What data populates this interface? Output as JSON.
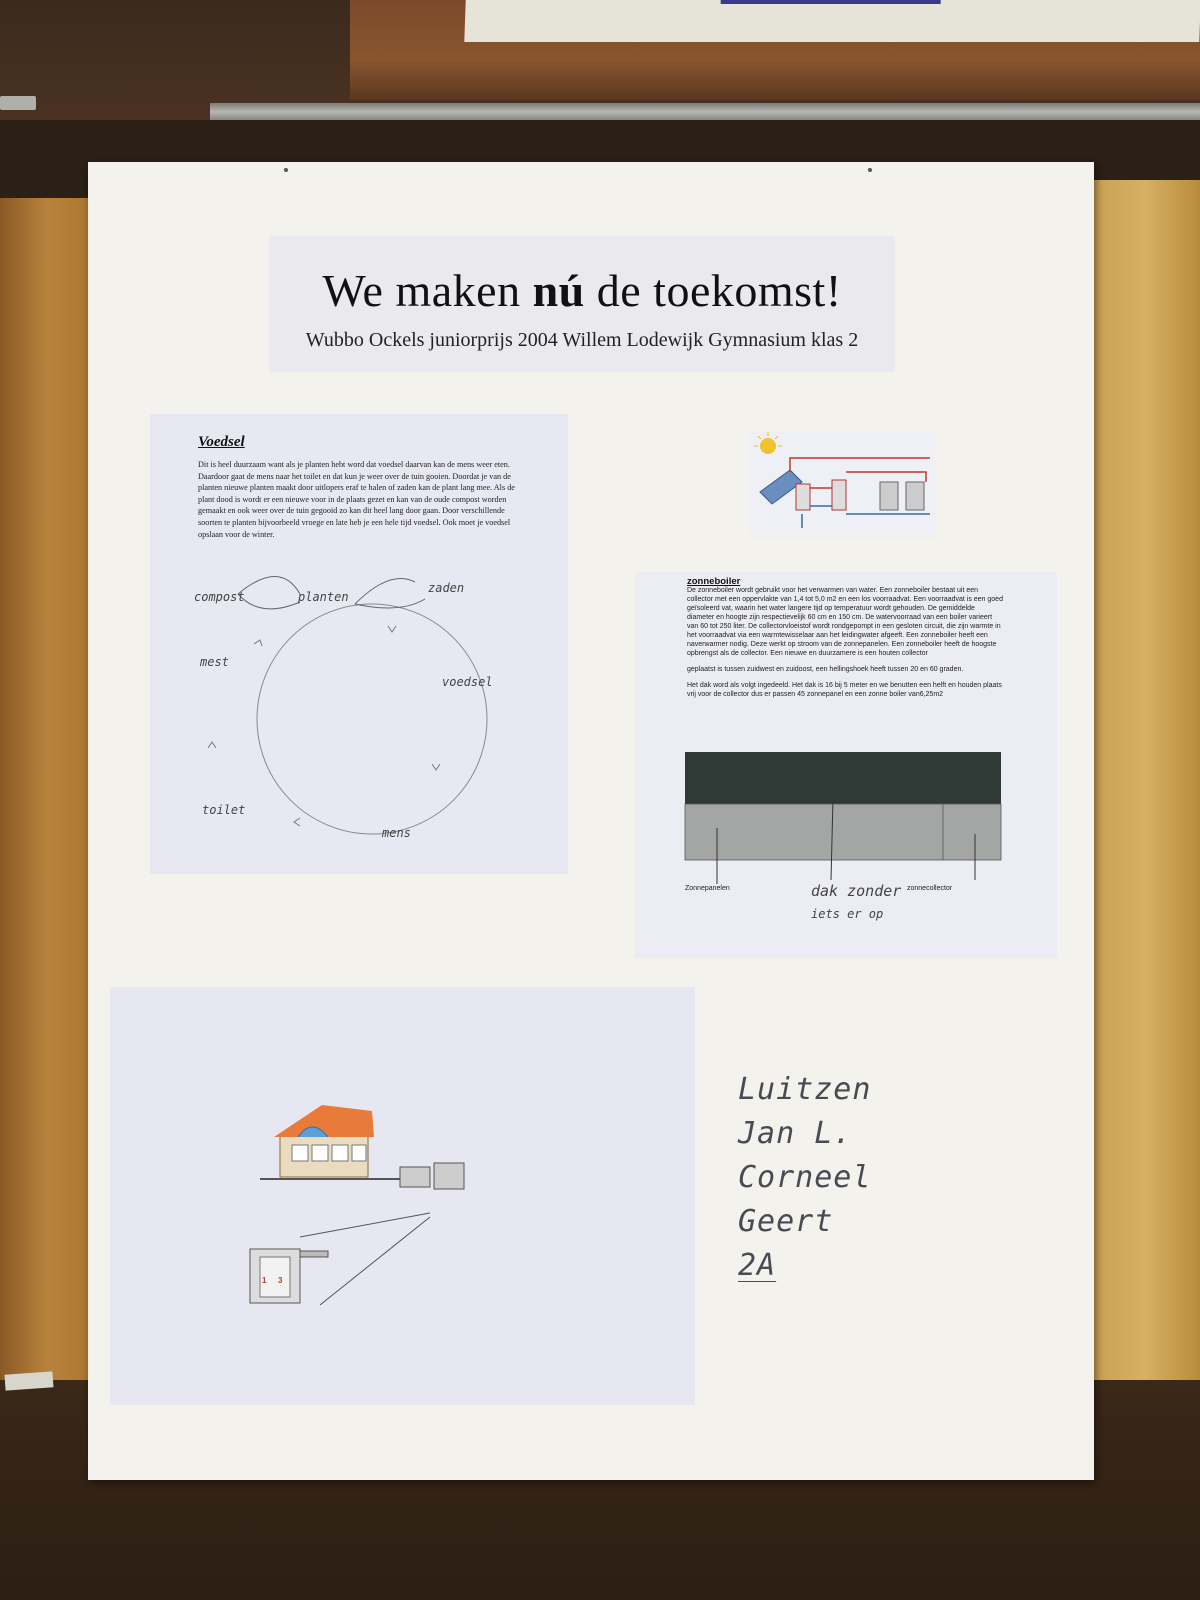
{
  "poster": {
    "title_pre": "We maken ",
    "title_bold": "nú",
    "title_post": " de toekomst!",
    "subtitle": "Wubbo Ockels juniorprijs 2004 Willem Lodewijk Gymnasium klas 2"
  },
  "voedsel": {
    "heading": "Voedsel",
    "body": "Dit is heel duurzaam want als je planten hebt word dat voedsel daarvan kan de mens weer eten. Daardoor gaat de mens naar het toilet en dat kun je weer over de tuin gooien. Doordat je van de planten nieuwe planten maakt door uitlopers eraf te halen of zaden kan de plant lang mee. Als de plant dood is wordt er een nieuwe voor in de plaats gezet en kan van de oude compost worden gemaakt en ook weer over de tuin gegooid zo kan dit heel lang door gaan. Door verschillende soorten te planten bijvoorbeeld vroege en late heb je een hele tijd voedsel. Ook moet je voedsel opslaan voor de winter.",
    "cycle": {
      "planten": "planten",
      "compost": "compost",
      "zaden": "zaden",
      "voedsel": "voedsel",
      "mens": "mens",
      "toilet": "toilet",
      "mest": "mest"
    }
  },
  "zonneboiler": {
    "heading": "zonneboiler",
    "para1": "De zonneboiler wordt gebruikt voor het verwarmen van water. Een zonneboiler bestaat uit een collector met een oppervlakte van 1,4 tot 5,0 m2 en een los voorraadvat. Een voorraadvat is een goed geïsoleerd vat, waarin het water langere tijd op temperatuur wordt gehouden. De gemiddelde diameter en hoogte zijn respectievelijk 60 cm en 150 cm. De watervoorraad van een boiler varieert van 60 tot 250 liter. De collectorvloeistof wordt rondgepompt in een gesloten circuit, die zijn warmte in het voorraadvat via een warmtewisselaar aan het leidingwater afgeeft. Een zonneboiler heeft een naverwarmer nodig. Deze werkt op stroom van de zonnepanelen. Een zonneboiler heeft de hoogste opbrengst als de collector. Een nieuwe en duurzamere is een houten collector",
    "para2": "geplaatst is tussen zuidwest en zuidoost, een hellingshoek heeft tussen 20 en 60 graden.",
    "para3": "Het dak word als volgt ingedeeld. Het dak is 16 bij 5 meter en we benutten een helft en houden plaats vrij voor de collector dus er passen 45 zonnepanel en een zonne boiler van6,25m2",
    "label_panels": "Zonnepanelen",
    "label_collector": "zonnecollector",
    "label_roof_1": "dak zonder",
    "label_roof_2": "iets er op"
  },
  "names": {
    "n1": "Luitzen",
    "n2": "Jan L.",
    "n3": "Corneel",
    "n4": "Geert",
    "class": "2A"
  },
  "colors": {
    "poster_bg": "#f3f2ec",
    "sheet_bg": "#e7e8f2",
    "roof_dark": "#2f3a36",
    "roof_light": "#a4a6a6",
    "septic_red": "#c0392b"
  }
}
